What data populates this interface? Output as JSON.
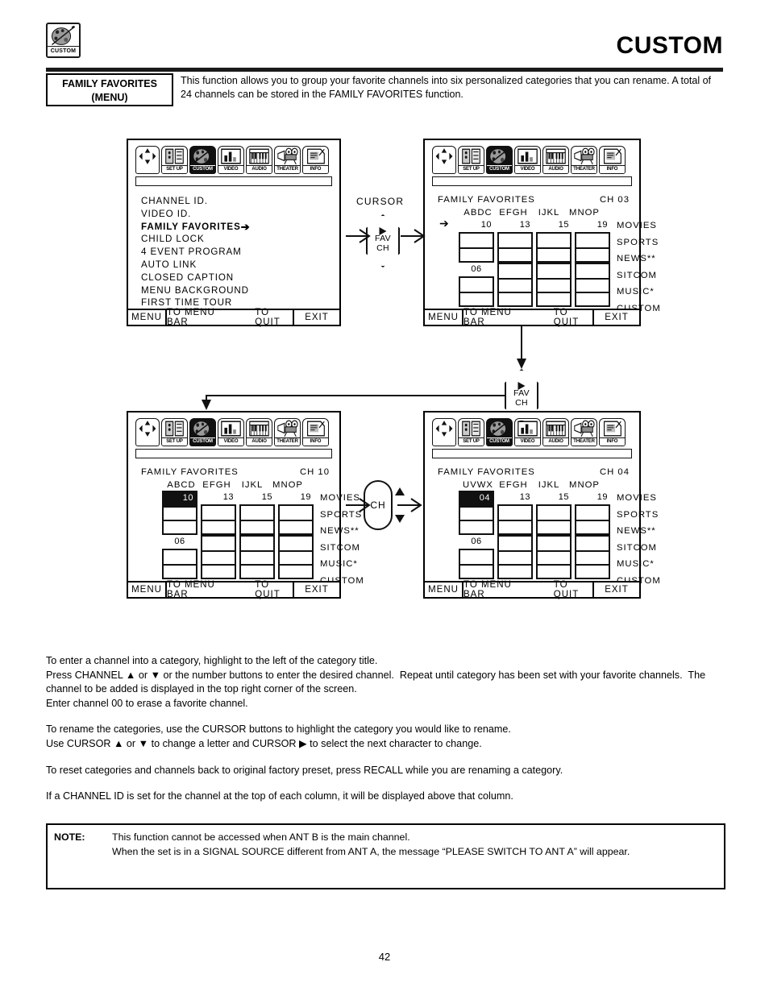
{
  "header": {
    "badge_label": "CUSTOM",
    "badge_icon": "palette-icon",
    "title": "CUSTOM"
  },
  "function_row": {
    "name_line1": "FAMILY FAVORITES",
    "name_line2": "(MENU)",
    "description": "This function allows you to group your favorite channels into six personalized categories that you can rename. A total of 24 channels can be stored in the FAMILY FAVORITES function."
  },
  "menu_bar": {
    "tiles": [
      {
        "label": "",
        "icon": "navigation-cross-icon",
        "selected": false
      },
      {
        "label": "SET UP",
        "icon": "setup-icon",
        "selected": false
      },
      {
        "label": "CUSTOM",
        "icon": "palette-icon",
        "selected": true
      },
      {
        "label": "VIDEO",
        "icon": "video-bars-icon",
        "selected": false
      },
      {
        "label": "AUDIO",
        "icon": "piano-keys-icon",
        "selected": false
      },
      {
        "label": "THEATER",
        "icon": "projector-icon",
        "selected": false
      },
      {
        "label": "INFO",
        "icon": "info-page-icon",
        "selected": false
      }
    ]
  },
  "footer_bar": {
    "menu": "MENU",
    "to_menu_bar": "TO MENU BAR",
    "to_quit": "TO QUIT",
    "exit": "EXIT"
  },
  "screens": {
    "a": {
      "name": "custom-menu-list",
      "options": [
        {
          "label": "CHANNEL ID.",
          "selected": false,
          "arrow": ""
        },
        {
          "label": "VIDEO ID.",
          "selected": false,
          "arrow": ""
        },
        {
          "label": "FAMILY FAVORITES",
          "selected": true,
          "arrow": "➔"
        },
        {
          "label": "CHILD LOCK",
          "selected": false,
          "arrow": ""
        },
        {
          "label": "4 EVENT PROGRAM",
          "selected": false,
          "arrow": ""
        },
        {
          "label": "AUTO LINK",
          "selected": false,
          "arrow": ""
        },
        {
          "label": "CLOSED CAPTION",
          "selected": false,
          "arrow": ""
        },
        {
          "label": "MENU BACKGROUND",
          "selected": false,
          "arrow": ""
        },
        {
          "label": "FIRST TIME TOUR",
          "selected": false,
          "arrow": ""
        }
      ]
    },
    "b": {
      "name": "family-favorites-cursor-state",
      "title": "FAMILY FAVORITES",
      "channel_readout": "CH 03",
      "column_ids": [
        "ABDC",
        "EFGH",
        "IJKL",
        "MNOP"
      ],
      "row_cursor": "➔",
      "columns": [
        {
          "top_value": "10",
          "top_highlighted": false,
          "mid_value": "06",
          "cells": [
            "",
            "",
            "",
            ""
          ]
        },
        {
          "top_value": "13",
          "top_highlighted": false,
          "mid_value": "",
          "cells": [
            "",
            "",
            "",
            ""
          ]
        },
        {
          "top_value": "15",
          "top_highlighted": false,
          "mid_value": "",
          "cells": [
            "",
            "",
            "",
            ""
          ]
        },
        {
          "top_value": "19",
          "top_highlighted": false,
          "mid_value": "",
          "cells": [
            "",
            "",
            "",
            ""
          ]
        }
      ],
      "categories": [
        "MOVIES",
        "SPORTS",
        "NEWS**",
        "SITCOM",
        "MUSIC*",
        "CUSTOM"
      ]
    },
    "c": {
      "name": "family-favorites-channel-10",
      "title": "FAMILY FAVORITES",
      "channel_readout": "CH 10",
      "column_ids": [
        "ABCD",
        "EFGH",
        "IJKL",
        "MNOP"
      ],
      "row_cursor": "",
      "columns": [
        {
          "top_value": "10",
          "top_highlighted": true,
          "mid_value": "06",
          "cells": [
            "",
            "",
            "",
            ""
          ]
        },
        {
          "top_value": "13",
          "top_highlighted": false,
          "mid_value": "",
          "cells": [
            "",
            "",
            "",
            ""
          ]
        },
        {
          "top_value": "15",
          "top_highlighted": false,
          "mid_value": "",
          "cells": [
            "",
            "",
            "",
            ""
          ]
        },
        {
          "top_value": "19",
          "top_highlighted": false,
          "mid_value": "",
          "cells": [
            "",
            "",
            "",
            ""
          ]
        }
      ],
      "categories": [
        "MOVIES",
        "SPORTS",
        "NEWS**",
        "SITCOM",
        "MUSIC*",
        "CUSTOM"
      ]
    },
    "d": {
      "name": "family-favorites-channel-04",
      "title": "FAMILY FAVORITES",
      "channel_readout": "CH 04",
      "column_ids": [
        "UVWX",
        "EFGH",
        "IJKL",
        "MNOP"
      ],
      "row_cursor": "",
      "columns": [
        {
          "top_value": "04",
          "top_highlighted": true,
          "mid_value": "06",
          "cells": [
            "",
            "",
            "",
            ""
          ]
        },
        {
          "top_value": "13",
          "top_highlighted": false,
          "mid_value": "",
          "cells": [
            "",
            "",
            "",
            ""
          ]
        },
        {
          "top_value": "15",
          "top_highlighted": false,
          "mid_value": "",
          "cells": [
            "",
            "",
            "",
            ""
          ]
        },
        {
          "top_value": "19",
          "top_highlighted": false,
          "mid_value": "",
          "cells": [
            "",
            "",
            "",
            ""
          ]
        }
      ],
      "categories": [
        "MOVIES",
        "SPORTS",
        "NEWS**",
        "SITCOM",
        "MUSIC*",
        "CUSTOM"
      ]
    }
  },
  "flow": {
    "cursor_label": "CURSOR",
    "fav_button_1": {
      "line1": "FAV",
      "line2": "CH"
    },
    "fav_button_2": {
      "line1": "FAV",
      "line2": "CH"
    },
    "ch_button": {
      "label": "CH"
    }
  },
  "body_paragraphs": [
    "To enter a channel into a category, highlight to the left of the category title.<br>Press CHANNEL ▲ or ▼ or the number buttons to enter the desired channel.&nbsp; Repeat until category has been set with your favorite channels.&nbsp; The channel to be added is displayed in the top right corner of the screen.<br>Enter channel 00 to erase a favorite channel.",
    "To rename the categories, use the CURSOR buttons to highlight the category you would like to rename.<br>Use CURSOR ▲ or ▼ to change a letter and CURSOR ▶ to select the next character to change.",
    "To reset categories and channels back to original factory preset, press RECALL while you are renaming a category.",
    "If a CHANNEL ID is set for the channel at the top of each column, it will be displayed above that column."
  ],
  "note": {
    "tag": "NOTE:",
    "line1": "This function cannot be accessed when ANT B is the main channel.",
    "line2": "When the set is in a SIGNAL SOURCE different from ANT A, the message “PLEASE SWITCH TO ANT A” will appear."
  },
  "page_number": "42"
}
